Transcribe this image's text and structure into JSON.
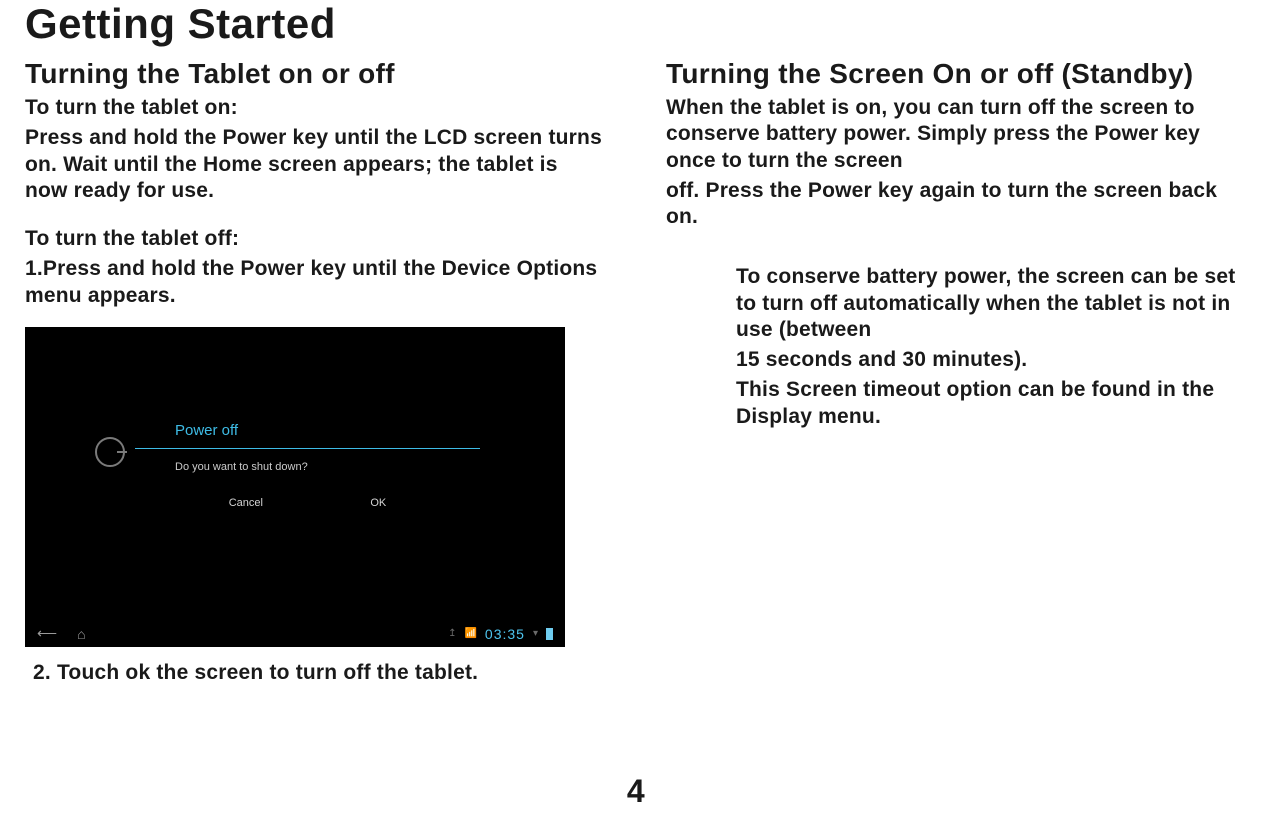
{
  "title": "Getting Started",
  "pageNumber": "4",
  "left": {
    "heading": "Turning the Tablet on or off",
    "onLabel": "To turn the tablet on:",
    "onBody": "Press and hold the Power key until the LCD screen turns on. Wait until the Home screen appears; the tablet is now ready for use.",
    "offLabel": "To turn the tablet off:",
    "offStep1": "1.Press and hold the Power key until the Device Options menu appears.",
    "offStep2": "2. Touch ok    the screen to turn off the tablet.",
    "screenshot": {
      "dialogTitle": "Power off",
      "dialogMessage": "Do you want to shut down?",
      "cancel": "Cancel",
      "ok": "OK",
      "clock": "03:35"
    }
  },
  "right": {
    "heading": "Turning the Screen On or off  (Standby)",
    "body1": "When the tablet is on, you can turn off the screen to conserve battery power. Simply press the Power key once to turn the screen",
    "body2": "off. Press the Power key again to turn the screen back on.",
    "note1": "To conserve battery power, the screen can be set to turn off automatically when the tablet is not in use (between",
    "note2": "15 seconds and 30 minutes).",
    "note3": "This Screen timeout option can be found in the Display menu."
  }
}
